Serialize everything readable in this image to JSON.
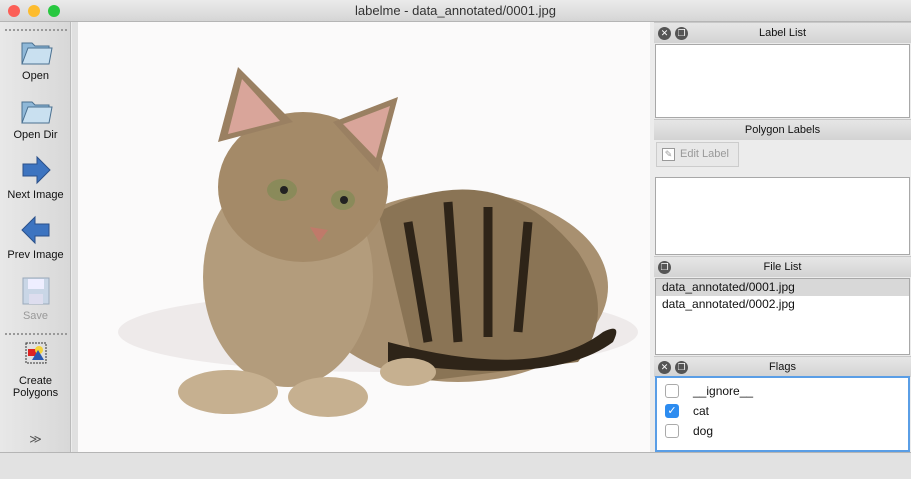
{
  "window": {
    "title": "labelme - data_annotated/0001.jpg"
  },
  "toolbar": {
    "items": [
      {
        "label": "Open",
        "icon": "folder-icon",
        "enabled": true
      },
      {
        "label": "Open Dir",
        "icon": "folder-icon",
        "enabled": true
      },
      {
        "label": "Next Image",
        "icon": "arrow-right-icon",
        "enabled": true
      },
      {
        "label": "Prev Image",
        "icon": "arrow-left-icon",
        "enabled": true
      },
      {
        "label": "Save",
        "icon": "floppy-icon",
        "enabled": false
      },
      {
        "label": "Create\nPolygons",
        "icon": "polygon-icon",
        "enabled": true
      }
    ],
    "more_icon": "double-chevron-down-icon"
  },
  "docks": {
    "label_list": {
      "title": "Label List",
      "items": []
    },
    "polygon_labels": {
      "title": "Polygon Labels",
      "edit_label": "Edit Label",
      "items": []
    },
    "file_list": {
      "title": "File List",
      "items": [
        "data_annotated/0001.jpg",
        "data_annotated/0002.jpg"
      ],
      "selected": 0
    },
    "flags": {
      "title": "Flags",
      "items": [
        {
          "label": "__ignore__",
          "checked": false
        },
        {
          "label": "cat",
          "checked": true
        },
        {
          "label": "dog",
          "checked": false
        }
      ]
    }
  },
  "colors": {
    "accent": "#2d8cf0",
    "focus_border": "#5a9ee6"
  }
}
